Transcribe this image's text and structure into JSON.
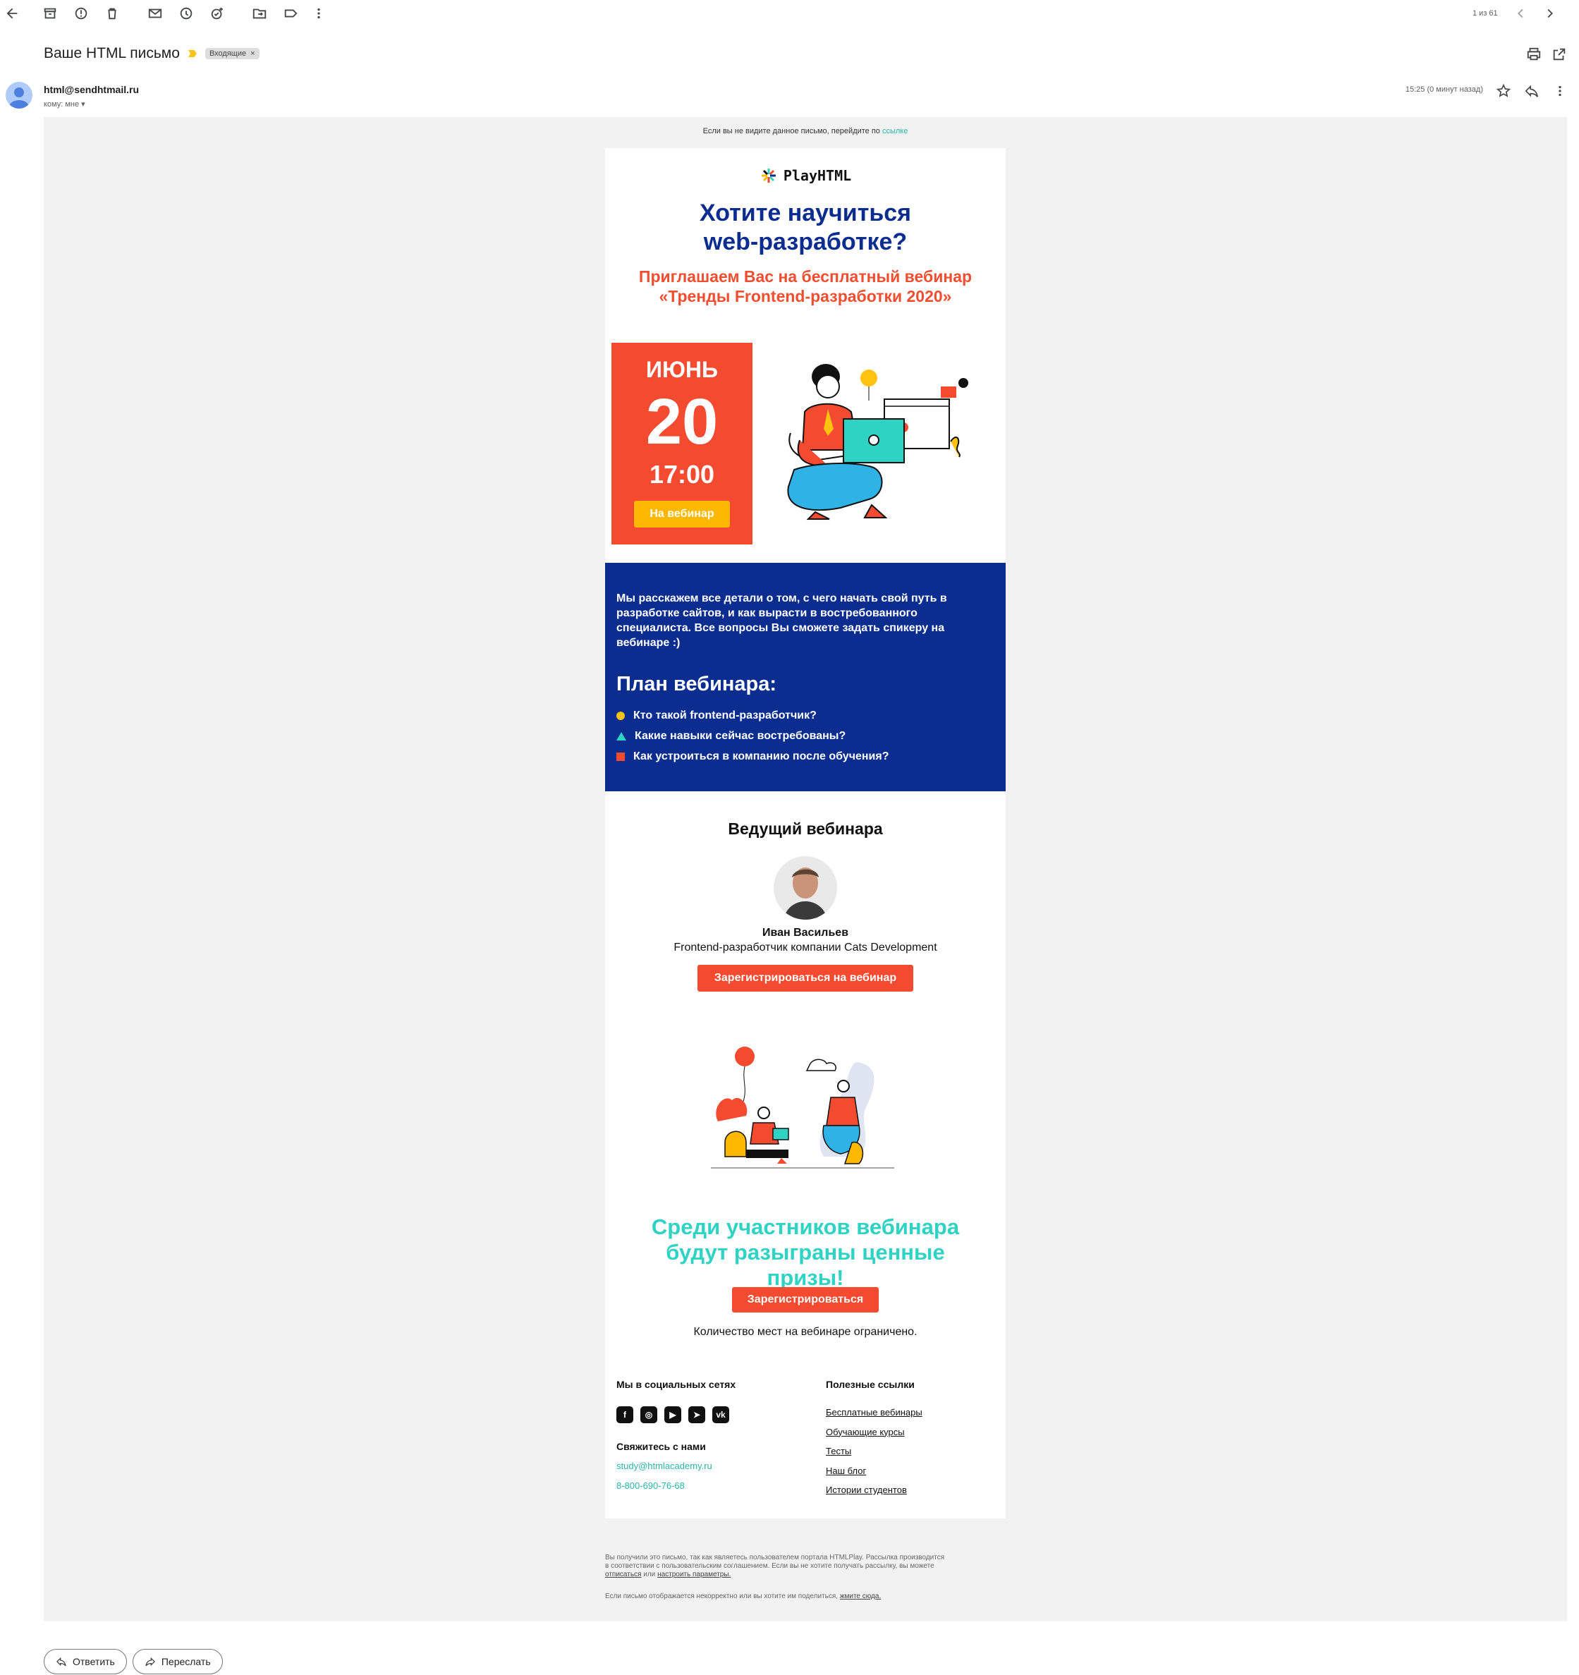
{
  "toolbar": {
    "icons": [
      "back-arrow-icon",
      "archive-icon",
      "report-spam-icon",
      "delete-icon",
      "mark-unread-icon",
      "snooze-icon",
      "add-task-icon",
      "move-to-icon",
      "label-icon",
      "more-vert-icon"
    ],
    "pagination": "1 из 61"
  },
  "message": {
    "subject": "Ваше HTML письмо",
    "label": "Входящие",
    "label_close": "×",
    "sender": "html@sendhtmail.ru",
    "to": "кому: мне",
    "time": "15:25 (0 минут назад)"
  },
  "email": {
    "preheader_text": "Если вы не видите данное письмо, перейдите по",
    "preheader_link": "ссылке",
    "logo": "PlayHTML",
    "headline": "Хотите научиться web-разработке?",
    "subheadline": "Приглашаем Вас на бесплатный вебинар «Тренды Frontend-разработки 2020»",
    "date": {
      "month": "ИЮНЬ",
      "day": "20",
      "time": "17:00",
      "button": "На вебинар"
    },
    "intro": "Мы расскажем все детали о том, с чего начать свой путь в разработке сайтов, и как вырасти в востребованного специалиста. Все вопросы Вы сможете задать спикеру на вебинаре :)",
    "plan_title": "План вебинара:",
    "plan": [
      "Кто такой frontend-разработчик?",
      "Какие навыки сейчас востребованы?",
      "Как устроиться в компанию после обучения?"
    ],
    "host_title": "Ведущий вебинара",
    "host_name": "Иван Васильев",
    "host_role": "Frontend-разработчик компании Cats Development",
    "register_webinar": "Зарегистрироваться на вебинар",
    "prize": "Среди участников вебинара будут разыграны ценные призы!",
    "register": "Зарегистрироваться",
    "limited": "Количество мест на вебинаре ограничено.",
    "social_title": "Мы в социальных сетях",
    "social_icons": [
      "facebook-icon",
      "instagram-icon",
      "youtube-icon",
      "telegram-icon",
      "vk-icon"
    ],
    "contact_title": "Свяжитесь с нами",
    "contact_email": "study@htmlacademy.ru",
    "contact_phone": "8-800-690-76-68",
    "links_title": "Полезные ссылки",
    "links": [
      "Бесплатные вебинары",
      "Обучающие курсы",
      "Тесты",
      "Наш блог",
      "Истории студентов"
    ],
    "legal1_a": "Вы получили это письмо, так как являетесь пользователем портала HTMLPlay. Рассылка производится",
    "legal1_b": "в соответствии с пользовательским соглашением. Если вы не хотите получать рассылку, вы можете",
    "legal1_unsub": "отписаться",
    "legal1_or": "или",
    "legal1_settings": "настроить параметры.",
    "legal2": "Если письмо отображается некорректно или вы хотите им поделиться,",
    "legal2_link": "жмите сюда."
  },
  "actions": {
    "reply": "Ответить",
    "forward": "Переслать"
  },
  "colors": {
    "navy": "#0a2d8f",
    "red": "#f44a2f",
    "teal": "#2fd3c3",
    "yellow": "#ffb800"
  }
}
